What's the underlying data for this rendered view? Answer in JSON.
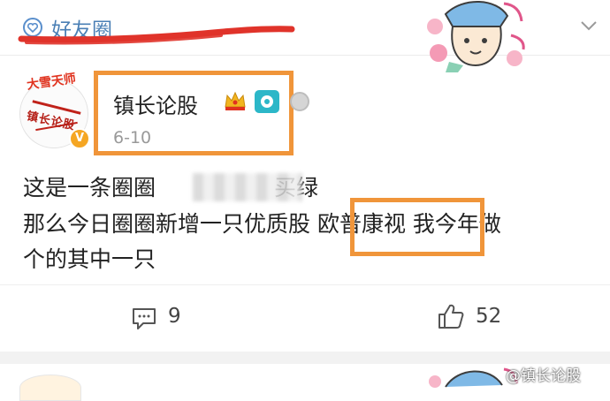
{
  "header": {
    "title": "好友圈",
    "icon": "heart-circle-icon",
    "chevron_icon": "chevron-down-icon",
    "accent_color": "#4a7fb5"
  },
  "post": {
    "username": "镇长论股",
    "date": "6-10",
    "badges": [
      "crown-vip-icon",
      "camera-icon",
      "gear-icon"
    ],
    "verified_mark": "V",
    "avatar": {
      "banner": "大雪天师",
      "text": "镇长论股"
    },
    "body_lines": [
      {
        "before": "这是一条圈圈 ",
        "blurred": true,
        "after": "买绿"
      },
      {
        "before": "那么今日圈圈新增一只优质股 ",
        "highlight": "欧普康视",
        "after": " 我今年做"
      },
      {
        "before": "个的其中一只"
      }
    ],
    "highlight_color": "#f0953a"
  },
  "actions": {
    "comment_icon": "comment-icon",
    "comment_count": "9",
    "like_icon": "thumbs-up-icon",
    "like_count": "52"
  },
  "watermark": "@镇长论股",
  "annotation_color": "#e0332a"
}
